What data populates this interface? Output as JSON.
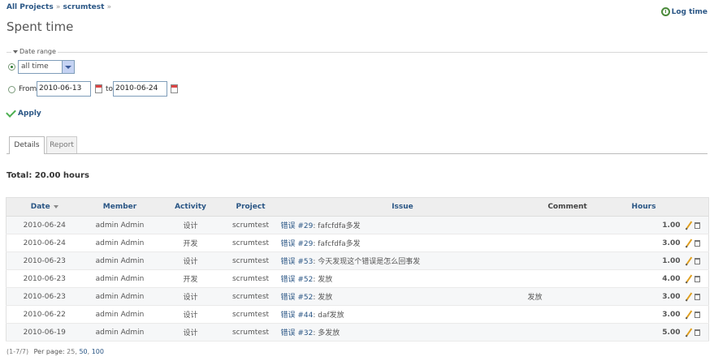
{
  "breadcrumb": {
    "root": "All Projects",
    "sep": "»",
    "project": "scrumtest",
    "trail": "»"
  },
  "page_title": "Spent time",
  "log_time_label": "Log time",
  "filter": {
    "legend": "Date range",
    "period_value": "all time",
    "from_label": "From",
    "from_value": "2010-06-13",
    "to_label": "to",
    "to_value": "2010-06-24"
  },
  "apply_label": "Apply",
  "tabs": [
    {
      "label": "Details"
    },
    {
      "label": "Report"
    }
  ],
  "total_label": "Total: 20.00 hours",
  "table": {
    "headers": {
      "date": "Date",
      "member": "Member",
      "activity": "Activity",
      "project": "Project",
      "issue": "Issue",
      "comment": "Comment",
      "hours": "Hours"
    },
    "rows": [
      {
        "date": "2010-06-24",
        "member": "admin Admin",
        "activity": "设计",
        "project": "scrumtest",
        "tracker": "错误",
        "num": "#29",
        "subject": ": fafcfdfa多发",
        "comment": "",
        "hours": "1.00"
      },
      {
        "date": "2010-06-24",
        "member": "admin Admin",
        "activity": "开发",
        "project": "scrumtest",
        "tracker": "错误",
        "num": "#29",
        "subject": ": fafcfdfa多发",
        "comment": "",
        "hours": "3.00"
      },
      {
        "date": "2010-06-23",
        "member": "admin Admin",
        "activity": "设计",
        "project": "scrumtest",
        "tracker": "错误",
        "num": "#53",
        "subject": ": 今天发现这个错误是怎么回事发",
        "comment": "",
        "hours": "1.00"
      },
      {
        "date": "2010-06-23",
        "member": "admin Admin",
        "activity": "开发",
        "project": "scrumtest",
        "tracker": "错误",
        "num": "#52",
        "subject": ": 发放",
        "comment": "",
        "hours": "4.00"
      },
      {
        "date": "2010-06-23",
        "member": "admin Admin",
        "activity": "设计",
        "project": "scrumtest",
        "tracker": "错误",
        "num": "#52",
        "subject": ": 发放",
        "comment": "发放",
        "hours": "3.00"
      },
      {
        "date": "2010-06-22",
        "member": "admin Admin",
        "activity": "设计",
        "project": "scrumtest",
        "tracker": "错误",
        "num": "#44",
        "subject": ": daf发放",
        "comment": "",
        "hours": "3.00"
      },
      {
        "date": "2010-06-19",
        "member": "admin Admin",
        "activity": "设计",
        "project": "scrumtest",
        "tracker": "错误",
        "num": "#32",
        "subject": ": 多发放",
        "comment": "",
        "hours": "5.00"
      }
    ]
  },
  "pagination": {
    "range": "(1-7/7)",
    "per_page": "Per page:",
    "options": [
      "25",
      "50",
      "100"
    ]
  }
}
